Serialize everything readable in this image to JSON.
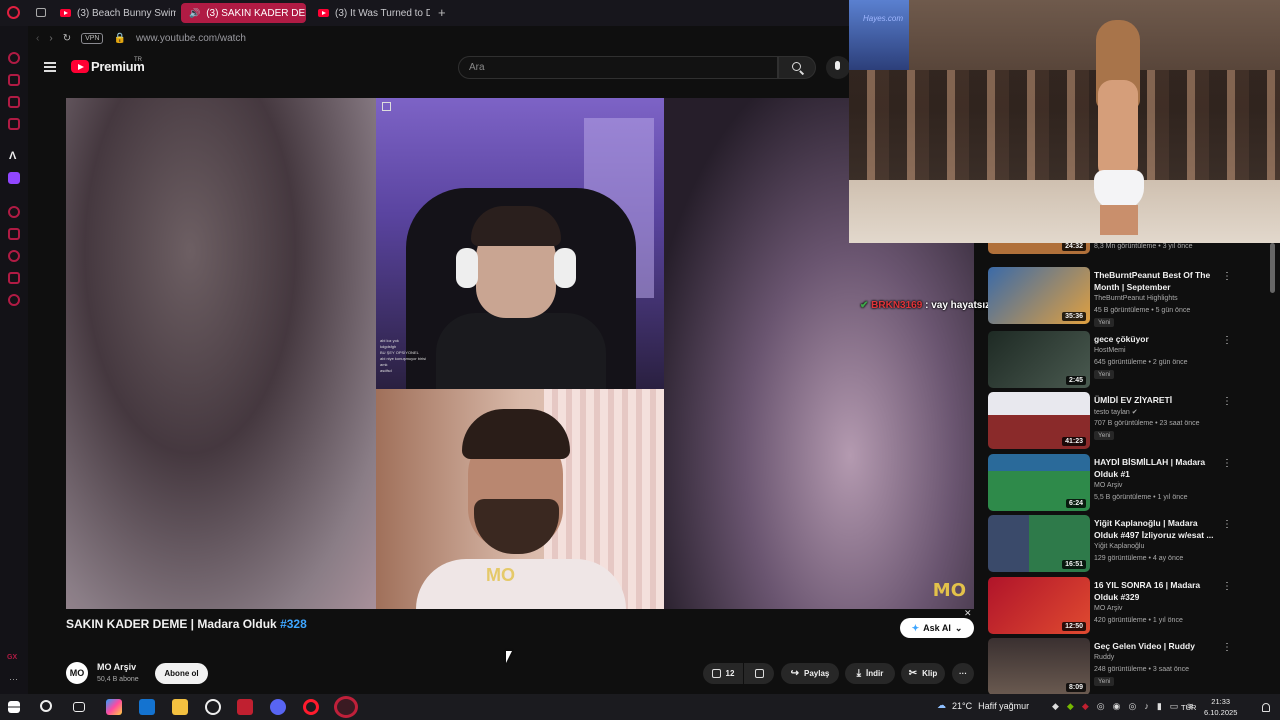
{
  "browser": {
    "tabs": [
      {
        "label": "(3) Beach Bunny Swimwe",
        "active": false
      },
      {
        "label": "(3) SAKIN KADER DEM",
        "active": true
      },
      {
        "label": "(3) It Was Turned to Dust",
        "active": false
      }
    ],
    "new_tab": "+",
    "vpn": "VPN",
    "url": "www.youtube.com/watch"
  },
  "youtube": {
    "logo": "Premium",
    "logo_sup": "TR",
    "search_placeholder": "Ara"
  },
  "video": {
    "title": "SAKIN KADER DEME | Madara Olduk",
    "hashtag": "#328",
    "watermark": "MO",
    "chat_overlay": [
      "abi kız yok",
      "kdgdsfgh",
      "BU ŞEY OPSİYONEL",
      "abi niye konuşmuyor birisi",
      "amk",
      "asdfsd"
    ]
  },
  "ask_ai": {
    "label": "Ask AI",
    "close": "✕"
  },
  "channel": {
    "avatar": "MO",
    "name": "MO Arşiv",
    "subs": "50,4 B abone",
    "subscribe": "Abone ol"
  },
  "actions": {
    "likes": "12",
    "share": "Paylaş",
    "download": "İndir",
    "clip": "Klip",
    "more": "···"
  },
  "live_chat": {
    "user": "BRKN3169",
    "message": ": vay hayatsız samed abim"
  },
  "related": [
    {
      "title": "",
      "channel": "",
      "meta": "8,3 Mn görüntüleme • 3 yıl önce",
      "duration": "24:32",
      "badge": "",
      "thumb": "#b0703a"
    },
    {
      "title": "TheBurntPeanut Best Of The Month | September",
      "channel": "TheBurntPeanut Highlights",
      "meta": "45 B görüntüleme • 5 gün önce",
      "duration": "35:36",
      "badge": "Yeni",
      "thumb": "#3a6aa8"
    },
    {
      "title": "gece çöküyor",
      "channel": "HostMemi",
      "meta": "645 görüntüleme • 2 gün önce",
      "duration": "2:45",
      "badge": "Yeni",
      "thumb": "#1e2a24"
    },
    {
      "title": "ÜMİDİ EV ZİYARETİ",
      "channel": "testo taylan",
      "meta": "707 B görüntüleme • 23 saat önce",
      "duration": "41:23",
      "badge": "Yeni",
      "thumb": "#8a2a2a"
    },
    {
      "title": "HAYDİ BİSMİLLAH | Madara Olduk #1",
      "channel": "MO Arşiv",
      "meta": "5,5 B görüntüleme • 1 yıl önce",
      "duration": "6:24",
      "badge": "",
      "thumb": "#2e8a4a"
    },
    {
      "title": "Yiğit Kaplanoğlu | Madara Olduk #497 İzliyoruz w/esat ...",
      "channel": "Yiğit Kaplanoğlu",
      "meta": "129 görüntüleme • 4 ay önce",
      "duration": "16:51",
      "badge": "",
      "thumb": "#3a4a6a"
    },
    {
      "title": "16 YIL SONRA 16 | Madara Olduk #329",
      "channel": "MO Arşiv",
      "meta": "420 görüntüleme • 1 yıl önce",
      "duration": "12:50",
      "badge": "",
      "thumb": "#b0142a"
    },
    {
      "title": "Geç Gelen Video | Ruddy",
      "channel": "Ruddy",
      "meta": "248 görüntüleme • 3 saat önce",
      "duration": "8:09",
      "badge": "Yeni",
      "thumb": "#3a3030"
    }
  ],
  "pip": {
    "watermark": "Hayes.com"
  },
  "taskbar": {
    "weather": "21°C",
    "weather_desc": "Hafif yağmur",
    "lang": "TUR",
    "time": "21:33",
    "date": "6.10.2025"
  },
  "colors": {
    "accent": "#b01b44",
    "yt_red": "#ff0033",
    "link": "#3ea6ff"
  }
}
